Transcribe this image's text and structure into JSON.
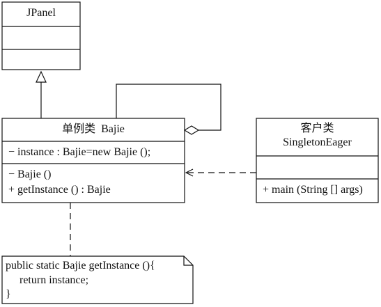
{
  "jpanel": {
    "name": "JPanel"
  },
  "bajie": {
    "name": "单例类  Bajie",
    "attributes": [
      "− instance : Bajie=new Bajie ();"
    ],
    "operations": [
      "− Bajie ()",
      "+ getInstance () : Bajie"
    ]
  },
  "client": {
    "name_line1": "客户类",
    "name_line2": "SingletonEager",
    "operations": [
      "+ main (String [] args)"
    ]
  },
  "note": {
    "lines": [
      "public static Bajie getInstance (){",
      "     return instance;",
      "}"
    ]
  }
}
